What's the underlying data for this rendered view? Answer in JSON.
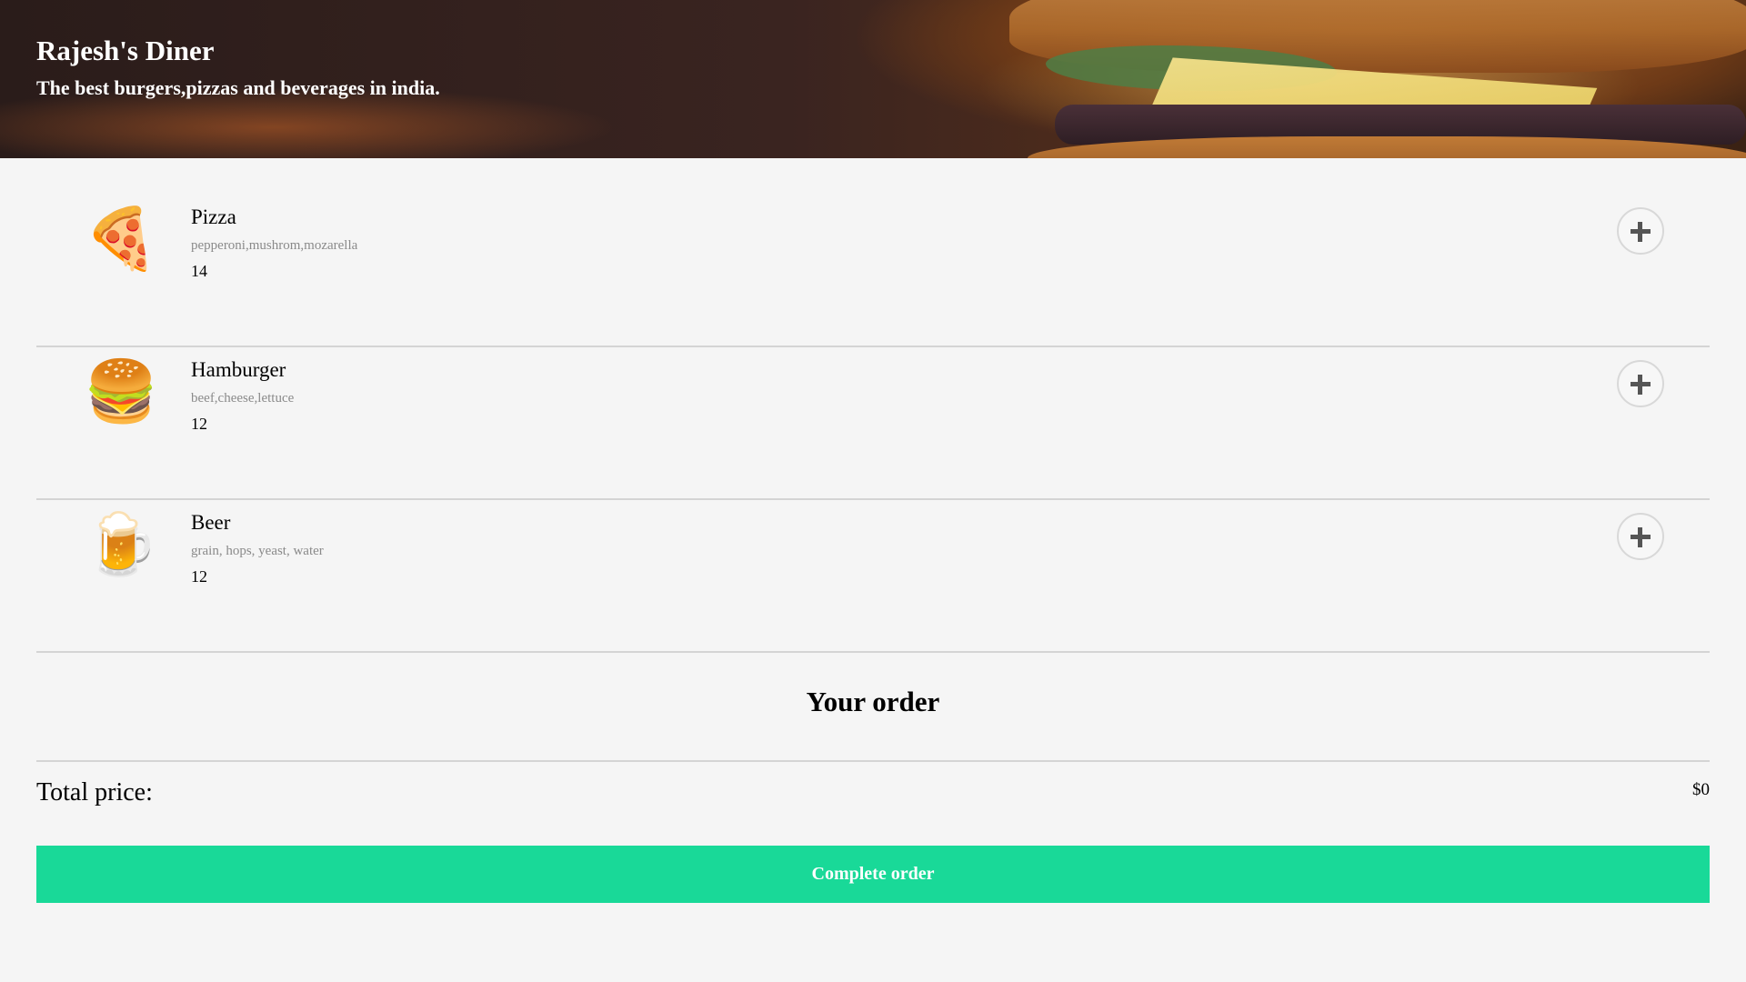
{
  "header": {
    "title": "Rajesh's Diner",
    "subtitle": "The best burgers,pizzas and beverages in india."
  },
  "menu": [
    {
      "emoji": "🍕",
      "icon": "pizza-icon",
      "name": "Pizza",
      "ingredients": "pepperoni,mushrom,mozarella",
      "price": "14"
    },
    {
      "emoji": "🍔",
      "icon": "hamburger-icon",
      "name": "Hamburger",
      "ingredients": "beef,cheese,lettuce",
      "price": "12"
    },
    {
      "emoji": "🍺",
      "icon": "beer-icon",
      "name": "Beer",
      "ingredients": "grain, hops, yeast, water",
      "price": "12"
    }
  ],
  "order": {
    "title": "Your order",
    "total_label": "Total price:",
    "total_value": "$0",
    "complete_label": "Complete order"
  },
  "colors": {
    "accent": "#19d998",
    "background": "#f5f5f5"
  }
}
